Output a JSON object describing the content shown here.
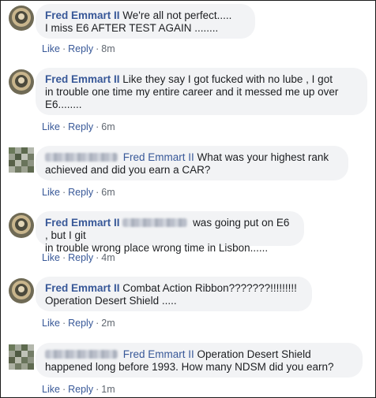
{
  "comments": [
    {
      "author": "Fred Emmart II",
      "text_line1": "We're all not perfect.....",
      "text_line2": "I miss E6 AFTER TEST AGAIN ........",
      "time": "8m"
    },
    {
      "author": "Fred Emmart II",
      "text_line1": "Like they say I got fucked with no lube , I got",
      "text_line2": "in trouble one time my entire career and it messed me up over",
      "text_line3": "E6........",
      "time": "6m"
    },
    {
      "mention": "Fred Emmart II",
      "text_line1": "What was your highest rank",
      "text_line2": "achieved and did you earn a CAR?",
      "time": "6m"
    },
    {
      "author": "Fred Emmart II",
      "text_line1": "was going put on E6 , but I git",
      "text_line2": "in trouble wrong place wrong time in Lisbon......",
      "time": "4m"
    },
    {
      "author": "Fred Emmart II",
      "text_line1": "Combat Action Ribbon???????!!!!!!!!!",
      "text_line2": "Operation Desert Shield .....",
      "time": "2m"
    },
    {
      "mention": "Fred Emmart II",
      "text_line1": "Operation Desert Shield",
      "text_line2": "happened long before 1993. How many NDSM did you earn?",
      "time": "1m"
    }
  ],
  "actions": {
    "like": "Like",
    "reply": "Reply",
    "separator": "·"
  }
}
